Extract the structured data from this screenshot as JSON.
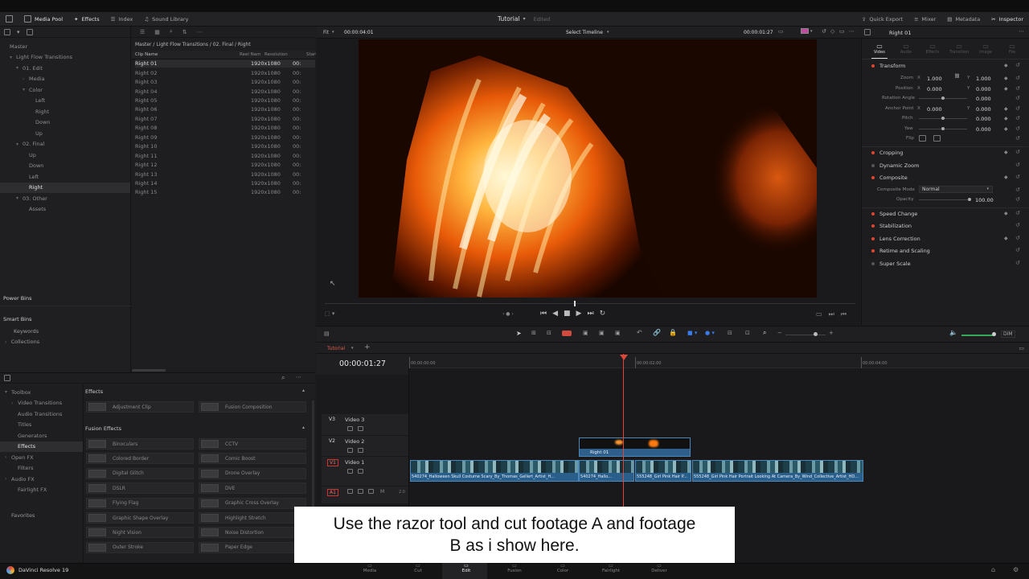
{
  "menubar": {
    "media_pool": "Media Pool",
    "effects": "Effects",
    "index": "Index",
    "sound_library": "Sound Library",
    "project_title": "Tutorial",
    "project_status": "Edited",
    "quick_export": "Quick Export",
    "mixer": "Mixer",
    "metadata": "Metadata",
    "inspector": "Inspector"
  },
  "viewer_bar": {
    "fit": "Fit",
    "source_tc": "00:00:04:01",
    "select_timeline": "Select Timeline",
    "record_tc": "00:00:01:27",
    "inspector_clip": "Right 01"
  },
  "bins": {
    "items": [
      {
        "label": "Master",
        "caret": "",
        "indent": 0
      },
      {
        "label": "Light Flow Transitions",
        "caret": "▾",
        "indent": 1
      },
      {
        "label": "01. Edit",
        "caret": "▾",
        "indent": 2
      },
      {
        "label": "Media",
        "caret": "›",
        "indent": 3
      },
      {
        "label": "Color",
        "caret": "▾",
        "indent": 3
      },
      {
        "label": "Left",
        "caret": "",
        "indent": 4
      },
      {
        "label": "Right",
        "caret": "",
        "indent": 4
      },
      {
        "label": "Down",
        "caret": "",
        "indent": 4
      },
      {
        "label": "Up",
        "caret": "",
        "indent": 4
      },
      {
        "label": "02. Final",
        "caret": "▾",
        "indent": 2
      },
      {
        "label": "Up",
        "caret": "",
        "indent": 3
      },
      {
        "label": "Down",
        "caret": "",
        "indent": 3
      },
      {
        "label": "Left",
        "caret": "",
        "indent": 3
      },
      {
        "label": "Right",
        "caret": "",
        "indent": 3
      },
      {
        "label": "03. Other",
        "caret": "▾",
        "indent": 2
      },
      {
        "label": "Assets",
        "caret": "",
        "indent": 3
      }
    ],
    "power_bins": "Power Bins",
    "smart_bins": "Smart Bins",
    "keywords": "Keywords",
    "collections": "Collections"
  },
  "clip_list": {
    "path": "Master / Light Flow Transitions / 02. Final / Right",
    "headers": [
      "Clip Name",
      "Reel Nam",
      "Resolution",
      "Start"
    ],
    "rows": [
      {
        "name": "Right 01",
        "res": "1920x1080",
        "start": "00:"
      },
      {
        "name": "Right 02",
        "res": "1920x1080",
        "start": "00:"
      },
      {
        "name": "Right 03",
        "res": "1920x1080",
        "start": "00:"
      },
      {
        "name": "Right 04",
        "res": "1920x1080",
        "start": "00:"
      },
      {
        "name": "Right 05",
        "res": "1920x1080",
        "start": "00:"
      },
      {
        "name": "Right 06",
        "res": "1920x1080",
        "start": "00:"
      },
      {
        "name": "Right 07",
        "res": "1920x1080",
        "start": "00:"
      },
      {
        "name": "Right 08",
        "res": "1920x1080",
        "start": "00:"
      },
      {
        "name": "Right 09",
        "res": "1920x1080",
        "start": "00:"
      },
      {
        "name": "Right 10",
        "res": "1920x1080",
        "start": "00:"
      },
      {
        "name": "Right 11",
        "res": "1920x1080",
        "start": "00:"
      },
      {
        "name": "Right 12",
        "res": "1920x1080",
        "start": "00:"
      },
      {
        "name": "Right 13",
        "res": "1920x1080",
        "start": "00:"
      },
      {
        "name": "Right 14",
        "res": "1920x1080",
        "start": "00:"
      },
      {
        "name": "Right 15",
        "res": "1920x1080",
        "start": "00:"
      }
    ]
  },
  "effects_panel": {
    "tree": [
      {
        "label": "Toolbox",
        "caret": "▾",
        "indent": 0
      },
      {
        "label": "Video Transitions",
        "caret": "›",
        "indent": 1
      },
      {
        "label": "Audio Transitions",
        "caret": "",
        "indent": 1
      },
      {
        "label": "Titles",
        "caret": "",
        "indent": 1
      },
      {
        "label": "Generators",
        "caret": "",
        "indent": 1
      },
      {
        "label": "Effects",
        "caret": "",
        "indent": 1
      },
      {
        "label": "Open FX",
        "caret": "›",
        "indent": 0
      },
      {
        "label": "Filters",
        "caret": "",
        "indent": 1
      },
      {
        "label": "Audio FX",
        "caret": "›",
        "indent": 0
      },
      {
        "label": "Fairlight FX",
        "caret": "",
        "indent": 1
      }
    ],
    "favorites": "Favorites",
    "section_effects": "Effects",
    "effects": [
      "Adjustment Clip",
      "Fusion Composition"
    ],
    "section_fusion": "Fusion Effects",
    "fusion": [
      "Binoculars",
      "CCTV",
      "Colored Border",
      "Comic Boost",
      "Digital Glitch",
      "Drone Overlay",
      "DSLR",
      "DVE",
      "Flying Flag",
      "Graphic Cross Overlay",
      "Graphic Shape Overlay",
      "Highlight Stretch",
      "Night Vision",
      "Noise Distortion",
      "Outer Stroke",
      "Paper Edge"
    ]
  },
  "inspector": {
    "tabs": [
      "Video",
      "Audio",
      "Effects",
      "Transition",
      "Image",
      "File"
    ],
    "transform": "Transform",
    "zoom_label": "Zoom",
    "zoom_x": "1.000",
    "zoom_y": "1.000",
    "position_label": "Position",
    "pos_x": "0.000",
    "pos_y": "0.000",
    "rotation_label": "Rotation Angle",
    "rotation": "0.000",
    "anchor_label": "Anchor Point",
    "anchor_x": "0.000",
    "anchor_y": "0.000",
    "pitch_label": "Pitch",
    "pitch": "0.000",
    "yaw_label": "Yaw",
    "yaw": "0.000",
    "flip_label": "Flip",
    "x_label": "X",
    "y_label": "Y",
    "cropping": "Cropping",
    "dynamic_zoom": "Dynamic Zoom",
    "composite": "Composite",
    "composite_mode_label": "Composite Mode",
    "composite_mode": "Normal",
    "opacity_label": "Opacity",
    "opacity": "100.00",
    "sections": [
      "Speed Change",
      "Stabilization",
      "Lens Correction",
      "Retime and Scaling",
      "Super Scale"
    ]
  },
  "timeline": {
    "tab": "Tutorial",
    "timecode": "00:00:01:27",
    "ruler": [
      "00:00:00:00",
      "00:00:02:00",
      "00:00:04:00"
    ],
    "tracks": [
      {
        "id": "V3",
        "name": "Video 3"
      },
      {
        "id": "V2",
        "name": "Video 2"
      },
      {
        "id": "V1",
        "name": "Video 1"
      },
      {
        "id": "A1",
        "name": ""
      }
    ],
    "a1_level": "2.0",
    "dim": "DIM",
    "v2_clip": "Right 01",
    "v1_clips": [
      "540274_Halloween Skull Costume Scary_By_Thomas_Gellert_Artist_H...",
      "540274_Hallo...",
      "555248_Girl Pink Hair P...",
      "555248_Girl Pink Hair Portrait Looking At Camera_By_Wind_Collective_Artist_HD..."
    ]
  },
  "pages": [
    "Media",
    "Cut",
    "Edit",
    "Fusion",
    "Color",
    "Fairlight",
    "Deliver"
  ],
  "app_name": "DaVinci Resolve 19",
  "caption": "Use the razor tool and cut footage A and footage B as i show here."
}
